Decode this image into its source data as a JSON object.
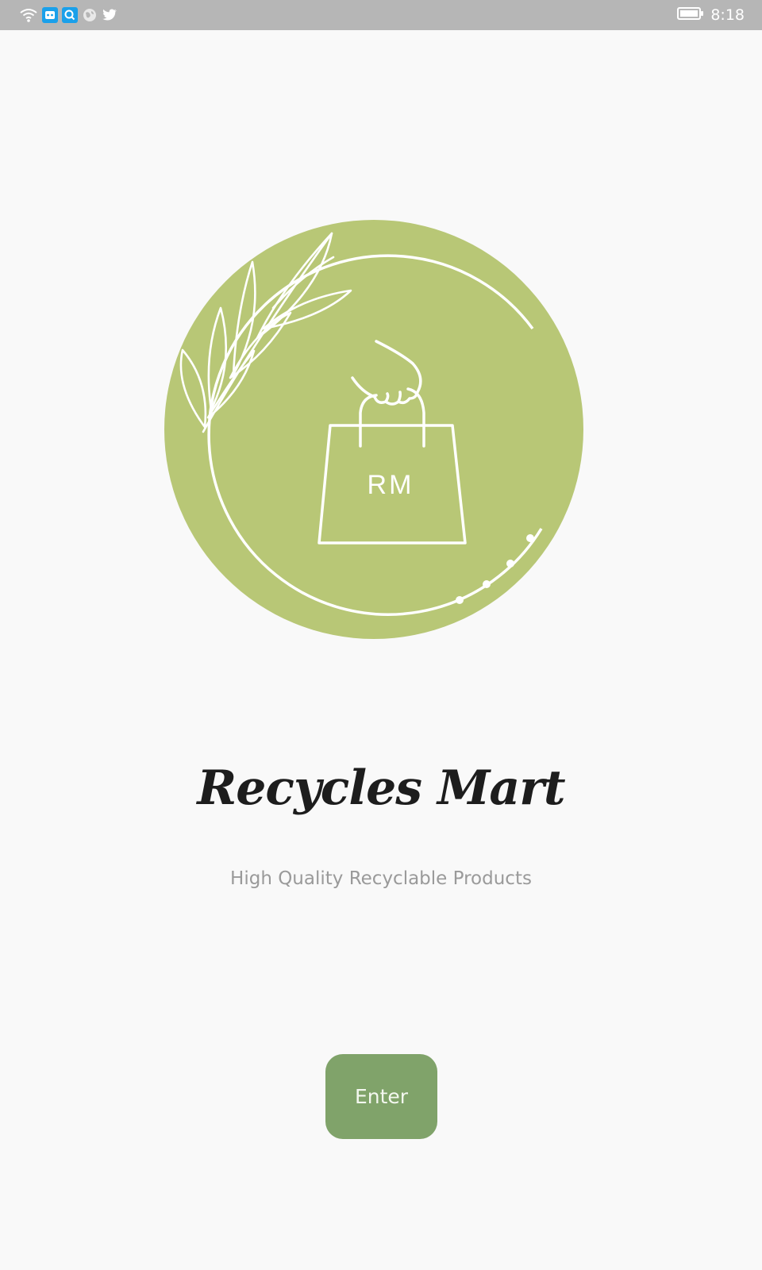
{
  "status_bar": {
    "time": "8:18",
    "icons": [
      "wifi-icon",
      "robot-app-icon",
      "search-app-icon",
      "globe-icon",
      "twitter-icon",
      "battery-icon"
    ]
  },
  "logo": {
    "monogram": "RM",
    "colors": {
      "circle": "#b8c776",
      "line": "#ffffff"
    }
  },
  "title": "Recycles Mart",
  "tagline": "High Quality Recyclable Products",
  "enter_button": {
    "label": "Enter",
    "color": "#80a36a"
  }
}
